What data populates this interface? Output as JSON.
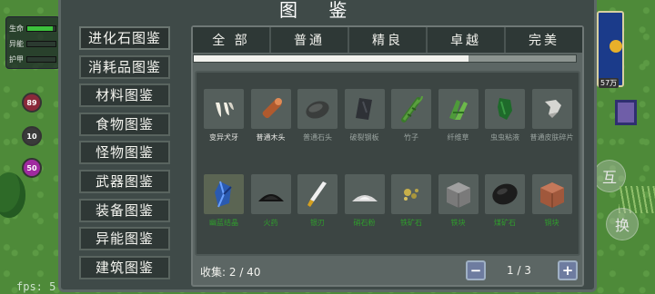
{
  "hud": {
    "rows": [
      {
        "label": "生命",
        "fill": 0.9,
        "color": "#3cc23c"
      },
      {
        "label": "异能",
        "fill": 0.0,
        "color": "#3a7bd5"
      },
      {
        "label": "护甲",
        "fill": 0.0,
        "color": "#d5c83a"
      }
    ],
    "orbs": [
      {
        "value": "89",
        "color": "#8a2a3a"
      },
      {
        "value": "10",
        "color": "#3a3a3a"
      },
      {
        "value": "50",
        "color": "#a02aa0"
      }
    ],
    "fps": "fps: 5"
  },
  "right": {
    "label": "57万",
    "button1": "互",
    "button2": "换"
  },
  "window": {
    "title": "图 鉴"
  },
  "categories": [
    "进化石图鉴",
    "消耗品图鉴",
    "材料图鉴",
    "食物图鉴",
    "怪物图鉴",
    "武器图鉴",
    "装备图鉴",
    "异能图鉴",
    "建筑图鉴"
  ],
  "tabs": [
    "全 部",
    "普通",
    "精良",
    "卓越",
    "完美"
  ],
  "collection_progress": 0.72,
  "items": [
    {
      "name": "变异犬牙",
      "state": "collected",
      "icon": "fang-icon"
    },
    {
      "name": "普通木头",
      "state": "collected",
      "icon": "wood-log-icon"
    },
    {
      "name": "普通石头",
      "state": "locked",
      "icon": "stone-icon"
    },
    {
      "name": "破裂钢板",
      "state": "locked",
      "icon": "steel-plate-icon"
    },
    {
      "name": "竹子",
      "state": "locked",
      "icon": "bamboo-icon"
    },
    {
      "name": "纤维草",
      "state": "locked",
      "icon": "fiber-grass-icon"
    },
    {
      "name": "虫虫粘液",
      "state": "locked",
      "icon": "slime-icon"
    },
    {
      "name": "普通皮肤碎片",
      "state": "locked",
      "icon": "skin-shard-icon"
    },
    {
      "name": "幽蓝结晶",
      "state": "locked-green",
      "icon": "blue-crystal-icon"
    },
    {
      "name": "火药",
      "state": "locked-green",
      "icon": "gunpowder-icon"
    },
    {
      "name": "银刃",
      "state": "locked-green",
      "icon": "blade-icon"
    },
    {
      "name": "硝石粉",
      "state": "locked-green",
      "icon": "saltpeter-icon"
    },
    {
      "name": "铁矿石",
      "state": "locked-green",
      "icon": "iron-ore-icon"
    },
    {
      "name": "铁块",
      "state": "locked-green",
      "icon": "iron-block-icon"
    },
    {
      "name": "煤矿石",
      "state": "locked-green",
      "icon": "coal-ore-icon"
    },
    {
      "name": "铜块",
      "state": "locked-green",
      "icon": "copper-block-icon"
    }
  ],
  "footer": {
    "label": "收集:",
    "count": "2 / 40",
    "page": "1 / 3",
    "prev": "−",
    "next": "+"
  }
}
